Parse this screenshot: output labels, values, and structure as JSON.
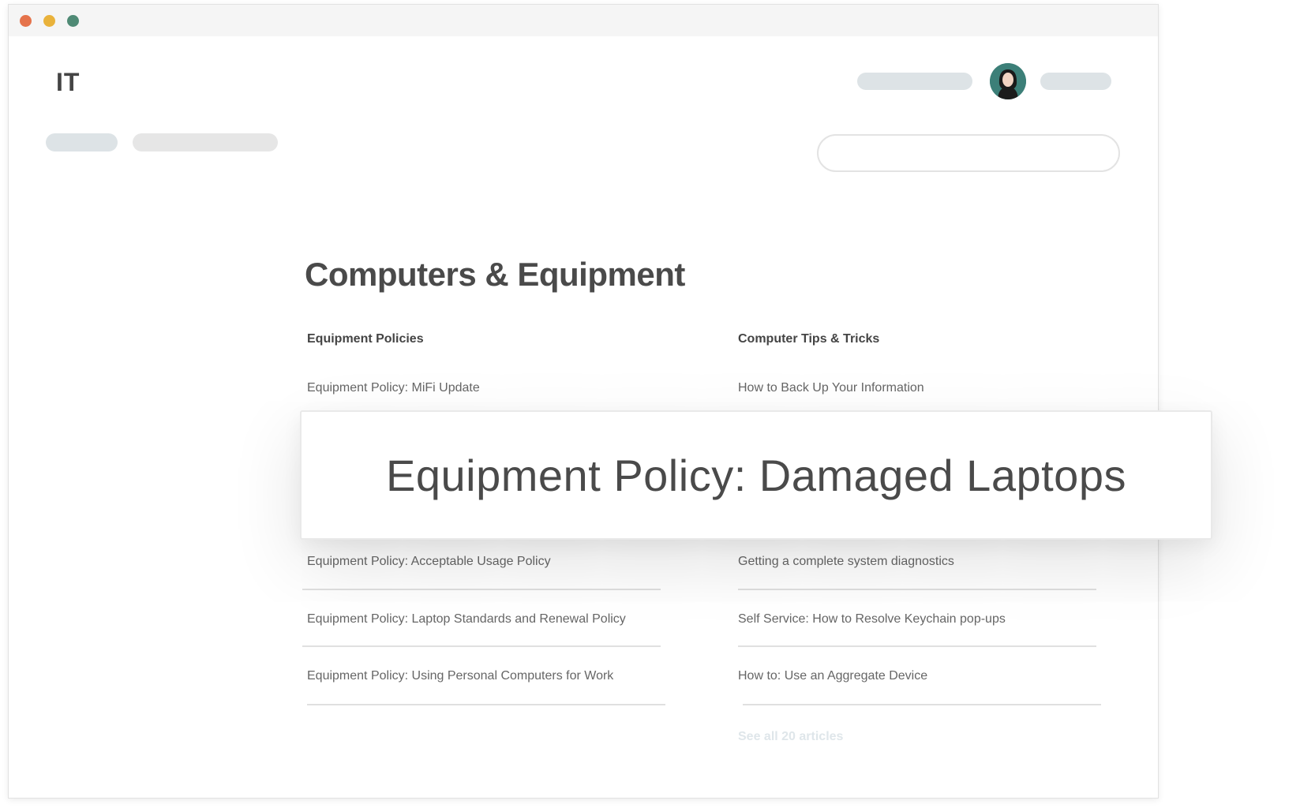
{
  "header": {
    "logo": "IT"
  },
  "main": {
    "title": "Computers & Equipment",
    "columns": [
      {
        "heading": "Equipment Policies",
        "articles": [
          "Equipment Policy: MiFi Update",
          "Equipment Policy: Acceptable Usage Policy",
          "Equipment Policy: Laptop Standards and Renewal Policy",
          "Equipment Policy: Using Personal Computers for Work"
        ]
      },
      {
        "heading": "Computer Tips & Tricks",
        "articles": [
          "How to Back Up Your Information",
          "Getting a complete system diagnostics",
          "Self Service: How to Resolve Keychain pop-ups",
          "How to: Use an Aggregate Device"
        ],
        "see_all": "See all 20 articles"
      }
    ]
  },
  "highlight": {
    "text": "Equipment Policy: Damaged Laptops"
  },
  "colors": {
    "placeholder": "#dde3e6",
    "avatar_bg": "#3c7f78",
    "text": "#4a4a4a"
  }
}
